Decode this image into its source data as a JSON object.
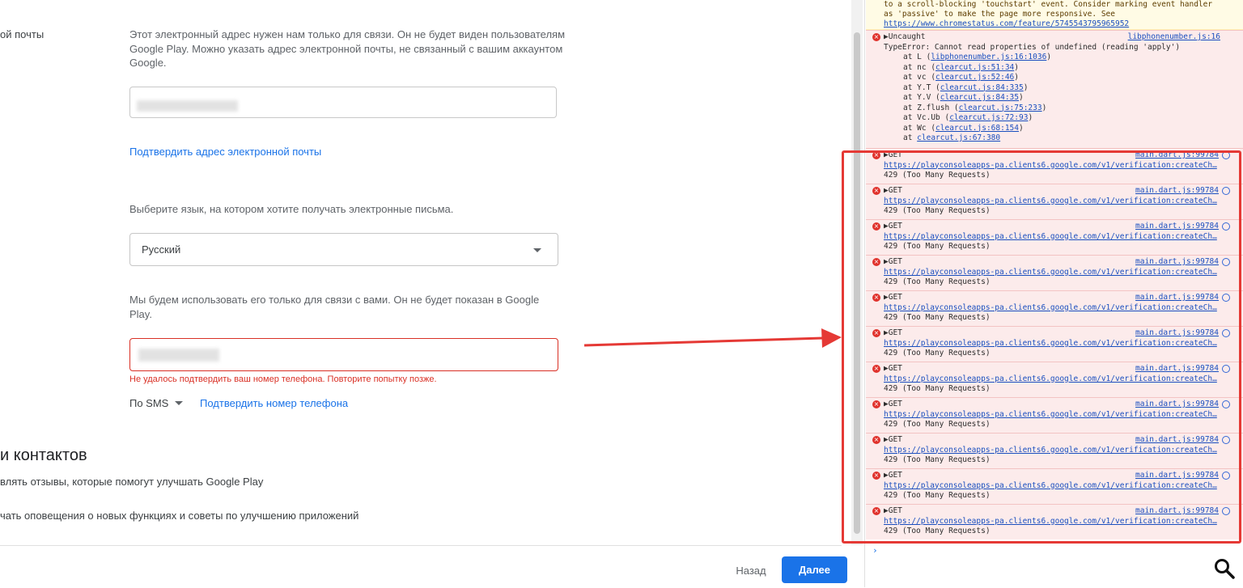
{
  "form": {
    "email_label_partial": "ой почты",
    "email_help": "Этот электронный адрес нужен нам только для связи. Он не будет виден пользователям Google Play. Можно указать адрес электронной почты, не связанный с вашим аккаунтом Google.",
    "verify_email_link": "Подтвердить адрес электронной почты",
    "language_help": "Выберите язык, на котором хотите получать электронные письма.",
    "language_selected": "Русский",
    "phone_help": "Мы будем использовать его только для связи с вами. Он не будет показан в Google Play.",
    "phone_error": "Не удалось подтвердить ваш номер телефона. Повторите попытку позже.",
    "sms_method": "По SMS",
    "verify_phone_link": "Подтвердить номер телефона",
    "section_title_partial": "и контактов",
    "feedback_text_partial": "влять отзывы, которые помогут улучшать Google Play",
    "notifications_text_partial": "чать оповещения о новых функциях и советы по улучшению приложений"
  },
  "footer": {
    "back_label": "Назад",
    "next_label": "Далее"
  },
  "console": {
    "warning_line1": "to a scroll-blocking 'touchstart' event. Consider marking event handler",
    "warning_line2": "as 'passive' to make the page more responsive. See",
    "warning_link": "https://www.chromestatus.com/feature/5745543795965952",
    "uncaught": {
      "title": "▶Uncaught",
      "source": "libphonenumber.js:16",
      "message": "TypeError: Cannot read properties of undefined (reading 'apply')",
      "stack": [
        {
          "fn": "at L (",
          "link": "libphonenumber.js:16:1036",
          "end": ")"
        },
        {
          "fn": "at nc (",
          "link": "clearcut.js:51:34",
          "end": ")"
        },
        {
          "fn": "at vc (",
          "link": "clearcut.js:52:46",
          "end": ")"
        },
        {
          "fn": "at Y.T (",
          "link": "clearcut.js:84:335",
          "end": ")"
        },
        {
          "fn": "at Y.V (",
          "link": "clearcut.js:84:35",
          "end": ")"
        },
        {
          "fn": "at Z.flush (",
          "link": "clearcut.js:75:233",
          "end": ")"
        },
        {
          "fn": "at Vc.Ub (",
          "link": "clearcut.js:72:93",
          "end": ")"
        },
        {
          "fn": "at Wc (",
          "link": "clearcut.js:68:154",
          "end": ")"
        },
        {
          "fn": "at ",
          "link": "clearcut.js:67:380",
          "end": ""
        }
      ]
    },
    "get_errors": [
      {
        "method": "▶GET",
        "source": "main.dart.js:99784",
        "url": "https://playconsoleapps-pa.clients6.google.com/v1/verification:createCh…",
        "status": "429 (Too Many Requests)"
      },
      {
        "method": "▶GET",
        "source": "main.dart.js:99784",
        "url": "https://playconsoleapps-pa.clients6.google.com/v1/verification:createCh…",
        "status": "429 (Too Many Requests)"
      },
      {
        "method": "▶GET",
        "source": "main.dart.js:99784",
        "url": "https://playconsoleapps-pa.clients6.google.com/v1/verification:createCh…",
        "status": "429 (Too Many Requests)"
      },
      {
        "method": "▶GET",
        "source": "main.dart.js:99784",
        "url": "https://playconsoleapps-pa.clients6.google.com/v1/verification:createCh…",
        "status": "429 (Too Many Requests)"
      },
      {
        "method": "▶GET",
        "source": "main.dart.js:99784",
        "url": "https://playconsoleapps-pa.clients6.google.com/v1/verification:createCh…",
        "status": "429 (Too Many Requests)"
      },
      {
        "method": "▶GET",
        "source": "main.dart.js:99784",
        "url": "https://playconsoleapps-pa.clients6.google.com/v1/verification:createCh…",
        "status": "429 (Too Many Requests)"
      },
      {
        "method": "▶GET",
        "source": "main.dart.js:99784",
        "url": "https://playconsoleapps-pa.clients6.google.com/v1/verification:createCh…",
        "status": "429 (Too Many Requests)"
      },
      {
        "method": "▶GET",
        "source": "main.dart.js:99784",
        "url": "https://playconsoleapps-pa.clients6.google.com/v1/verification:createCh…",
        "status": "429 (Too Many Requests)"
      },
      {
        "method": "▶GET",
        "source": "main.dart.js:99784",
        "url": "https://playconsoleapps-pa.clients6.google.com/v1/verification:createCh…",
        "status": "429 (Too Many Requests)"
      },
      {
        "method": "▶GET",
        "source": "main.dart.js:99784",
        "url": "https://playconsoleapps-pa.clients6.google.com/v1/verification:createCh…",
        "status": "429 (Too Many Requests)"
      },
      {
        "method": "▶GET",
        "source": "main.dart.js:99784",
        "url": "https://playconsoleapps-pa.clients6.google.com/v1/verification:createCh…",
        "status": "429 (Too Many Requests)"
      }
    ],
    "prompt_symbol": "›"
  },
  "colors": {
    "accent": "#1a73e8",
    "error": "#d93025",
    "highlight": "#e53935"
  },
  "icons": {
    "error": "error-circle-icon",
    "network": "globe-icon",
    "search": "search-icon"
  }
}
